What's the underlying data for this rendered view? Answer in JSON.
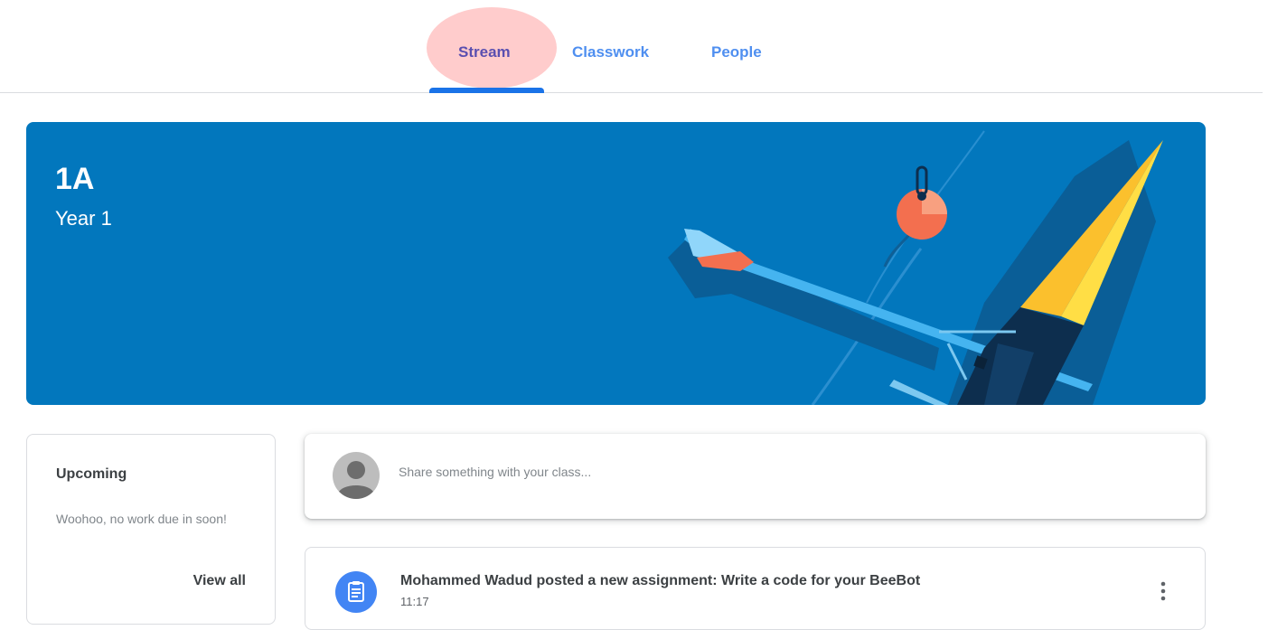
{
  "tabs": [
    {
      "label": "Stream",
      "active": true
    },
    {
      "label": "Classwork",
      "active": false
    },
    {
      "label": "People",
      "active": false
    }
  ],
  "banner": {
    "title": "1A",
    "subtitle": "Year 1",
    "color": "#0277bd"
  },
  "upcoming": {
    "title": "Upcoming",
    "message": "Woohoo, no work due in soon!",
    "view_all_label": "View all"
  },
  "share": {
    "placeholder": "Share something with your class..."
  },
  "posts": [
    {
      "title": "Mohammed Wadud posted a new assignment: Write a code for your BeeBot",
      "time": "11:17",
      "icon": "assignment-icon"
    }
  ],
  "colors": {
    "accent": "#1a73e8",
    "tab_text": "#4f8ff0",
    "assignment_icon_bg": "#4285f4"
  }
}
